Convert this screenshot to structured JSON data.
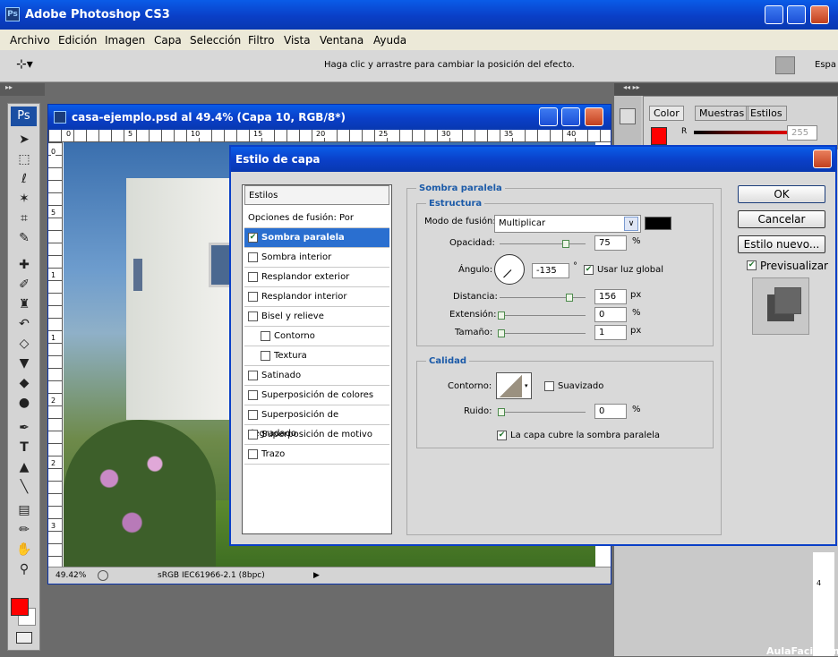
{
  "app": {
    "title": "Adobe Photoshop CS3"
  },
  "menu": [
    "Archivo",
    "Edición",
    "Imagen",
    "Capa",
    "Selección",
    "Filtro",
    "Vista",
    "Ventana",
    "Ayuda"
  ],
  "options_bar": {
    "hint": "Haga clic y arrastre para cambiar la posición del efecto.",
    "workspace": "Espa"
  },
  "document": {
    "title": "casa-ejemplo.psd al 49.4% (Capa 10, RGB/8*)",
    "zoom": "49.42%",
    "profile": "sRGB IEC61966-2.1 (8bpc)",
    "ruler_h": [
      "0",
      "5",
      "10",
      "15",
      "20",
      "25",
      "30",
      "35",
      "40"
    ],
    "ruler_v": [
      "0",
      "5",
      "1",
      "1",
      "2",
      "2",
      "3"
    ]
  },
  "panel": {
    "tabs": [
      "Color",
      "Muestras",
      "Estilos"
    ],
    "channel": "R",
    "value": "255"
  },
  "dialog": {
    "title": "Estilo de capa",
    "styles_header": "Estilos",
    "blend_options": "Opciones de fusión: Por defecto",
    "styles": [
      {
        "label": "Sombra paralela",
        "checked": true,
        "selected": true
      },
      {
        "label": "Sombra interior",
        "checked": false
      },
      {
        "label": "Resplandor exterior",
        "checked": false
      },
      {
        "label": "Resplandor interior",
        "checked": false
      },
      {
        "label": "Bisel y relieve",
        "checked": false
      },
      {
        "label": "Contorno",
        "checked": false
      },
      {
        "label": "Textura",
        "checked": false
      },
      {
        "label": "Satinado",
        "checked": false
      },
      {
        "label": "Superposición de colores",
        "checked": false
      },
      {
        "label": "Superposición de degradado",
        "checked": false
      },
      {
        "label": "Superposición de motivo",
        "checked": false
      },
      {
        "label": "Trazo",
        "checked": false
      }
    ],
    "section_title": "Sombra paralela",
    "structure": {
      "title": "Estructura",
      "blend_mode_label": "Modo de fusión:",
      "blend_mode": "Multiplicar",
      "opacity_label": "Opacidad:",
      "opacity": "75",
      "angle_label": "Ángulo:",
      "angle": "-135",
      "global_light": "Usar luz global",
      "distance_label": "Distancia:",
      "distance": "156",
      "spread_label": "Extensión:",
      "spread": "0",
      "size_label": "Tamaño:",
      "size": "1",
      "unit_pct": "%",
      "unit_px": "px",
      "unit_deg": "°"
    },
    "quality": {
      "title": "Calidad",
      "contour_label": "Contorno:",
      "antialias": "Suavizado",
      "noise_label": "Ruido:",
      "noise": "0",
      "knockout": "La capa cubre la sombra paralela"
    },
    "buttons": {
      "ok": "OK",
      "cancel": "Cancelar",
      "new_style": "Estilo nuevo...",
      "preview": "Previsualizar"
    }
  },
  "watermark": "AulaFacil.com",
  "colors": {
    "foreground": "#ff0000",
    "titlebar": "#0a5ce8",
    "dialog_accent": "#2a6fd0"
  },
  "icons": [
    "move-icon",
    "marquee-icon",
    "lasso-icon",
    "magic-wand-icon",
    "crop-icon",
    "slice-icon",
    "healing-icon",
    "brush-icon",
    "stamp-icon",
    "history-brush-icon",
    "eraser-icon",
    "bucket-icon",
    "blur-icon",
    "dodge-icon",
    "pen-icon",
    "type-icon",
    "path-select-icon",
    "line-icon",
    "notes-icon",
    "eyedropper-icon",
    "hand-icon",
    "zoom-icon"
  ]
}
